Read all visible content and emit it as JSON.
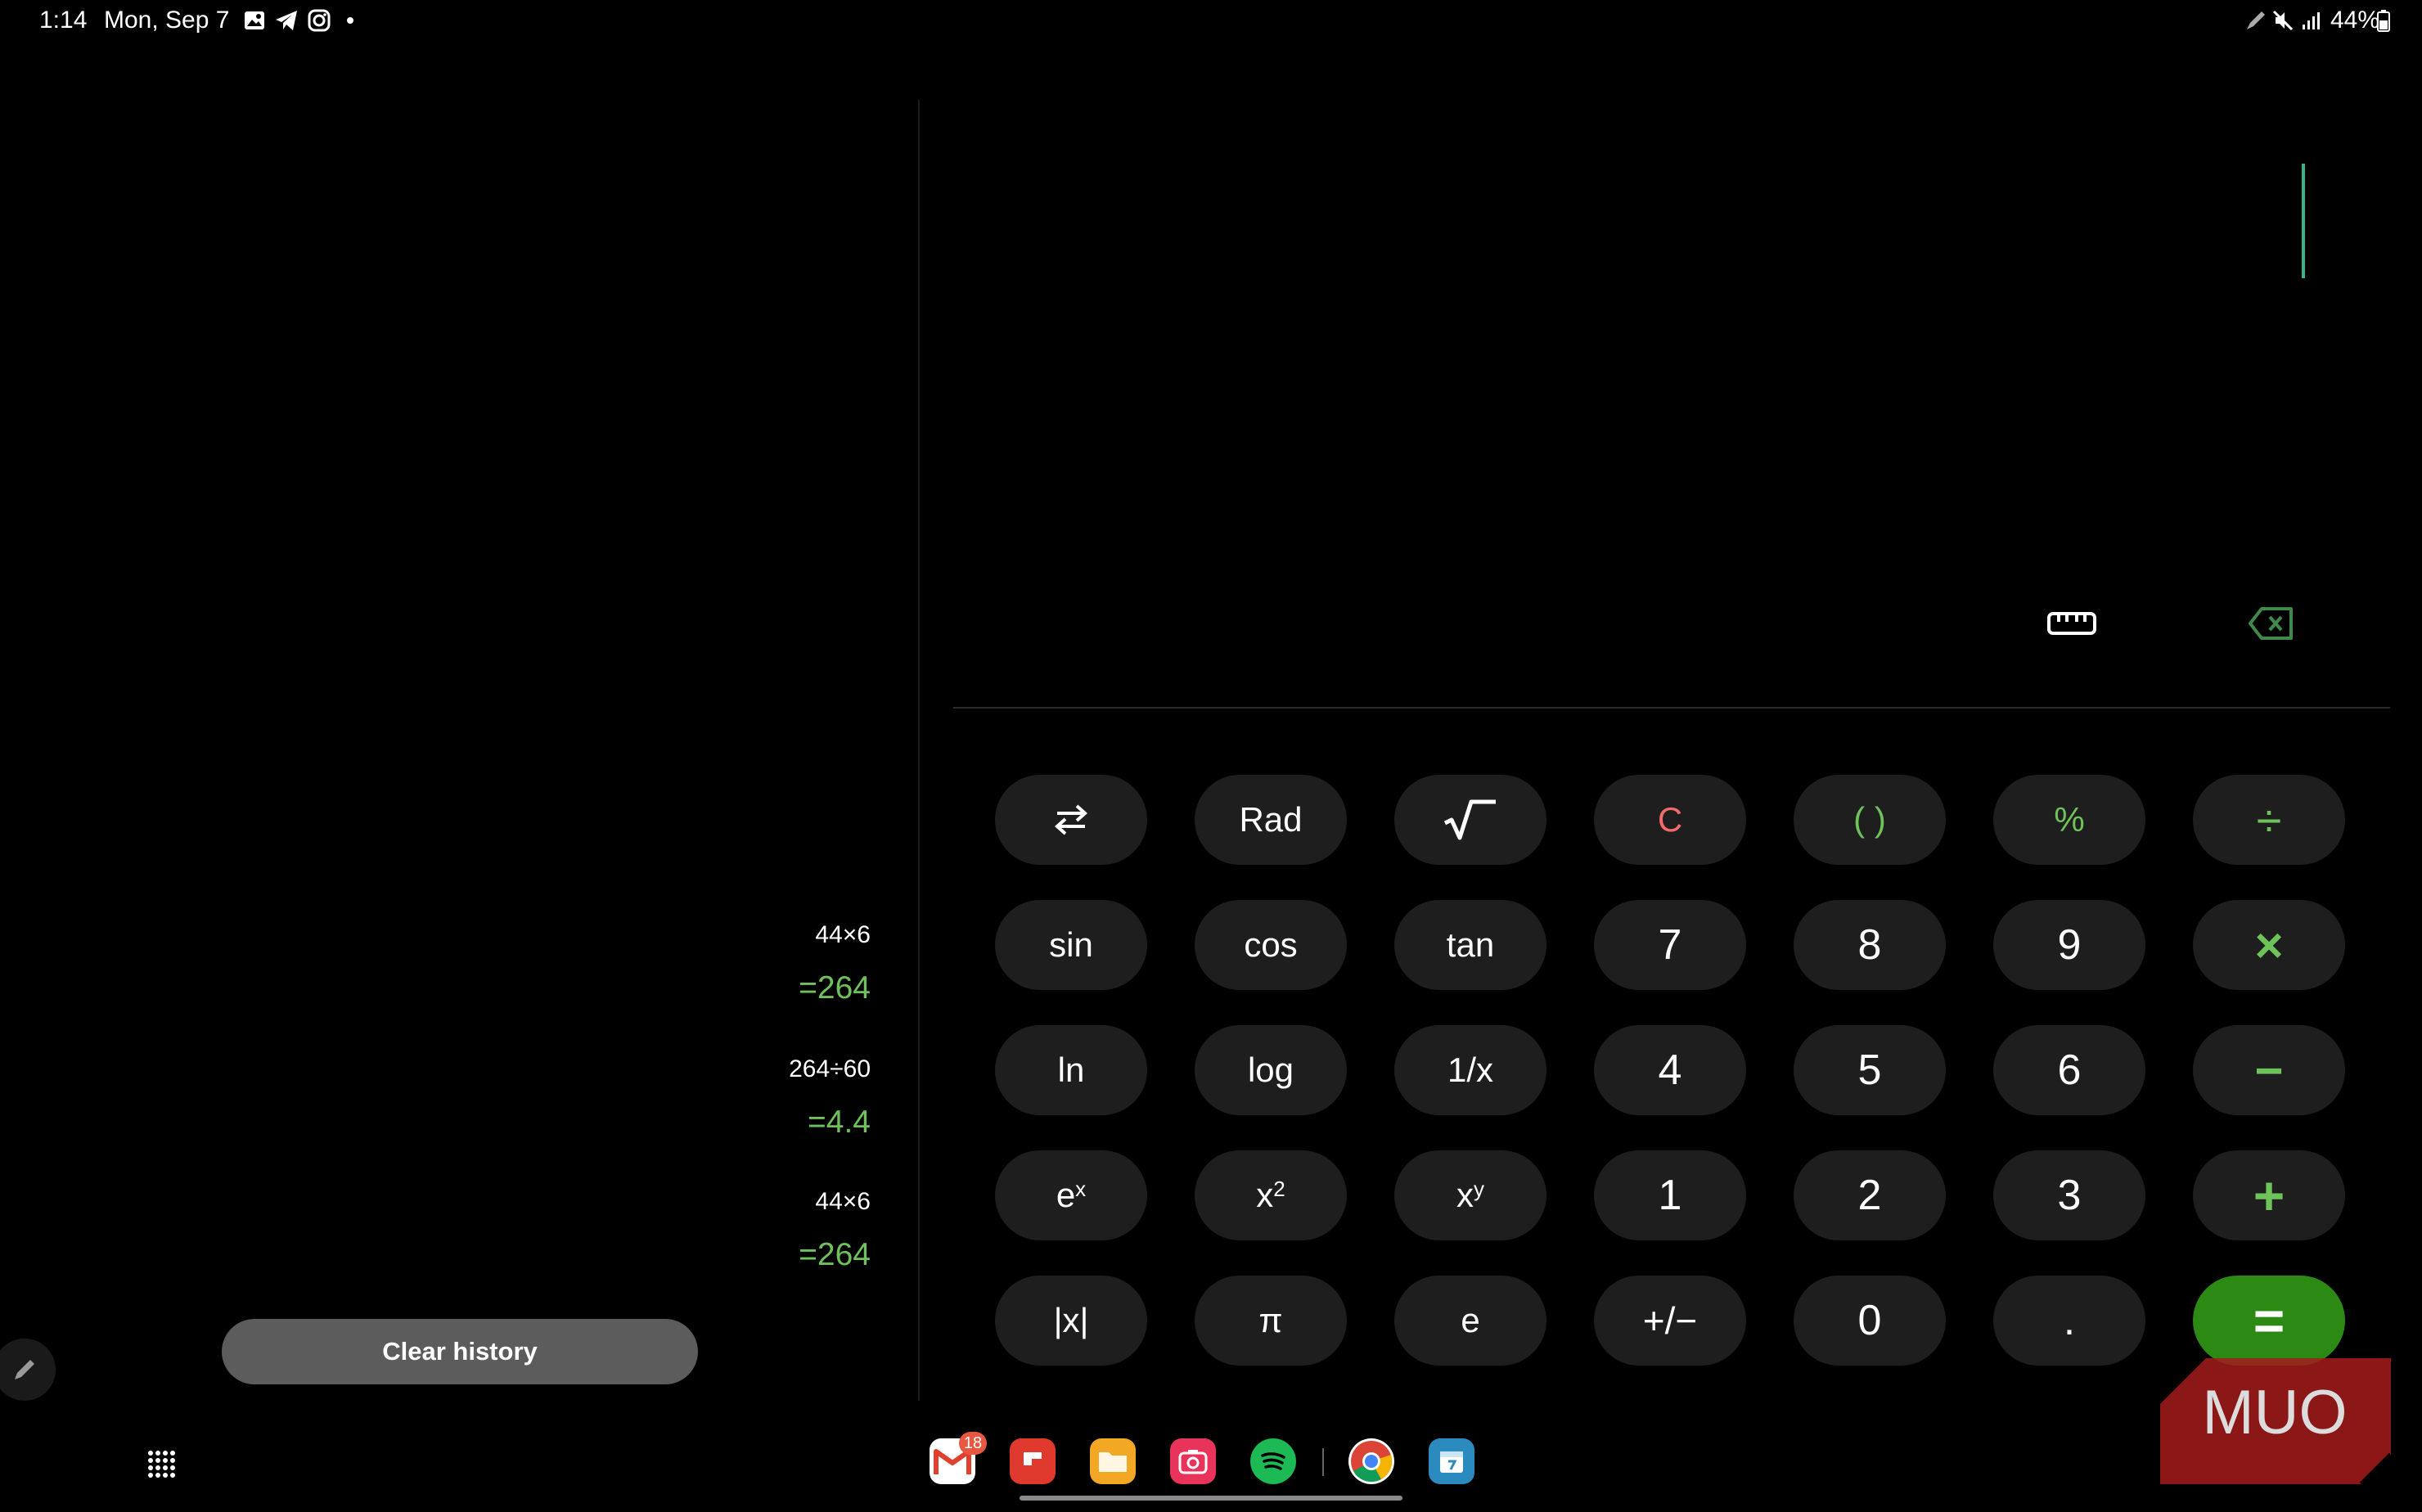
{
  "status_bar": {
    "time": "1:14",
    "date": "Mon, Sep 7",
    "battery": "44%",
    "left_icons": [
      "gallery-icon",
      "telegram-icon",
      "instagram-icon",
      "dot-icon"
    ],
    "right_icons": [
      "pen-icon",
      "mute-icon",
      "signal-icon",
      "battery-icon"
    ]
  },
  "history": [
    {
      "expression": "44×6",
      "result": "=264"
    },
    {
      "expression": "264÷60",
      "result": "=4.4"
    },
    {
      "expression": "44×6",
      "result": "=264"
    }
  ],
  "clear_history_label": "Clear history",
  "display": {
    "toolbar_icons": [
      "unit-converter-icon",
      "backspace-icon"
    ]
  },
  "keypad": {
    "row1": [
      "⇆",
      "Rad",
      "√",
      "C",
      "( )",
      "%",
      "÷"
    ],
    "row2": [
      "sin",
      "cos",
      "tan",
      "7",
      "8",
      "9",
      "×"
    ],
    "row3": [
      "ln",
      "log",
      "1/x",
      "4",
      "5",
      "6",
      "−"
    ],
    "row4_plain": [
      "1",
      "2",
      "3",
      "+"
    ],
    "row4_pow": [
      {
        "base": "e",
        "exp": "x"
      },
      {
        "base": "x",
        "exp": "2"
      },
      {
        "base": "x",
        "exp": "y"
      }
    ],
    "row5": [
      "|x|",
      "π",
      "e",
      "+/−",
      "0",
      ".",
      "="
    ]
  },
  "taskbar": {
    "gmail_badge": "18",
    "apps": [
      "gmail-icon",
      "flipboard-icon",
      "files-icon",
      "camera-icon",
      "spotify-icon",
      "chrome-icon",
      "calendar-icon"
    ]
  },
  "watermark": "MUO",
  "colors": {
    "accent_green": "#6ec25a",
    "equals_bg": "#2c8a14",
    "clear_red": "#f26b6b",
    "key_bg": "#1e1e1e"
  }
}
